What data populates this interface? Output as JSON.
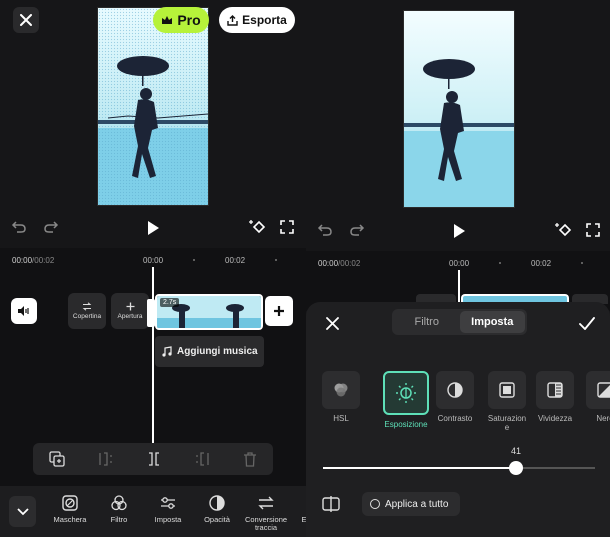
{
  "left": {
    "pro_label": "Pro",
    "export_label": "Esporta",
    "time_current": "00:00",
    "time_total": "/00:02",
    "ruler_labels": [
      "00:00",
      "00:02"
    ],
    "side_buttons": [
      {
        "label": "Copertina",
        "icon": "swap-icon"
      },
      {
        "label": "Apertura",
        "icon": "plus-icon"
      }
    ],
    "clip_duration": "2.7s",
    "add_music_label": "Aggiungi musica",
    "toolbar": [
      {
        "label": "Maschera",
        "icon": "mask-icon"
      },
      {
        "label": "Filtro",
        "icon": "filter-icon"
      },
      {
        "label": "Imposta",
        "icon": "sliders-icon"
      },
      {
        "label": "Opacità",
        "icon": "opacity-icon"
      },
      {
        "label": "Conversione traccia",
        "icon": "convert-icon"
      },
      {
        "label": "E",
        "icon": ""
      }
    ]
  },
  "right": {
    "time_current": "00:00",
    "time_total": "/00:02",
    "ruler_labels": [
      "00:00",
      "00:02"
    ],
    "tabs": [
      {
        "label": "Filtro",
        "active": false
      },
      {
        "label": "Imposta",
        "active": true
      }
    ],
    "adjustments": [
      {
        "label": "HSL",
        "icon": "hsl-icon",
        "active": false
      },
      {
        "label": "Esposizione",
        "icon": "exposure-icon",
        "active": true
      },
      {
        "label": "Contrasto",
        "icon": "contrast-icon",
        "active": false
      },
      {
        "label": "Saturazione",
        "icon": "saturation-icon",
        "active": false
      },
      {
        "label": "Vividezza",
        "icon": "vibrance-icon",
        "active": false
      },
      {
        "label": "Nero",
        "icon": "black-icon",
        "active": false
      }
    ],
    "slider_value": "41",
    "slider_fraction": 0.71,
    "apply_all_label": "Applica a tutto"
  },
  "colors": {
    "accent_pro": "#b6f23a",
    "accent_active": "#5ee0b8"
  }
}
